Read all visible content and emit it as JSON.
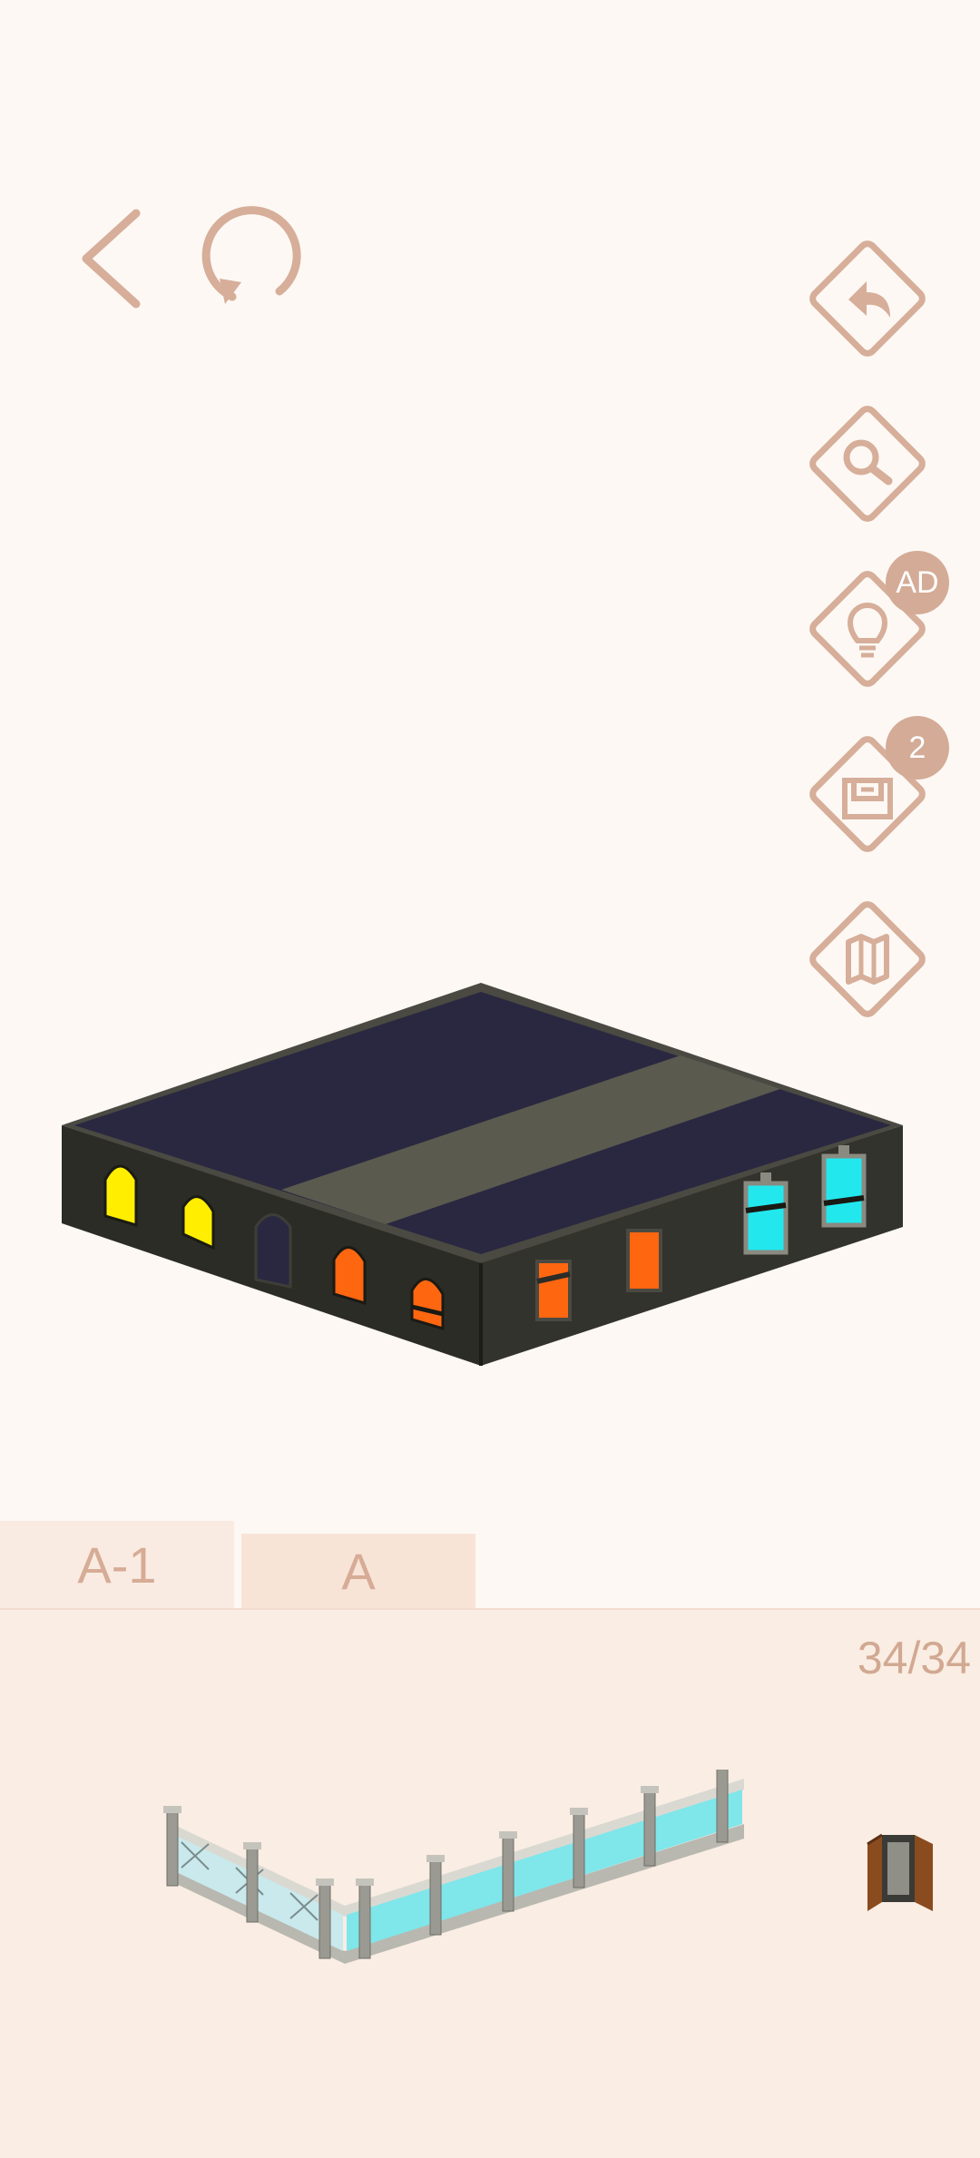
{
  "top_bar": {
    "back_icon": "chevron-left-icon",
    "restart_icon": "restart-icon"
  },
  "side_tools": [
    {
      "name": "undo",
      "icon": "undo-arrow-icon"
    },
    {
      "name": "zoom",
      "icon": "magnifier-icon"
    },
    {
      "name": "hint",
      "icon": "lightbulb-icon",
      "badge": "AD"
    },
    {
      "name": "piece-storage",
      "icon": "drawer-icon",
      "badge": "2"
    },
    {
      "name": "map",
      "icon": "map-icon"
    }
  ],
  "tabs": [
    {
      "label": "A-1",
      "active": true
    },
    {
      "label": "A",
      "active": false
    }
  ],
  "piece_counter": "34/34",
  "colors": {
    "accent": "#d4ab96",
    "background": "#fdf8f4",
    "tray": "#faede3",
    "roof_dark": "#2a2840",
    "roof_stripe": "#5a5a4f",
    "wall": "#32322c",
    "window_yellow": "#ffee00",
    "window_orange": "#ff6610",
    "window_cyan": "#22e8ee"
  }
}
